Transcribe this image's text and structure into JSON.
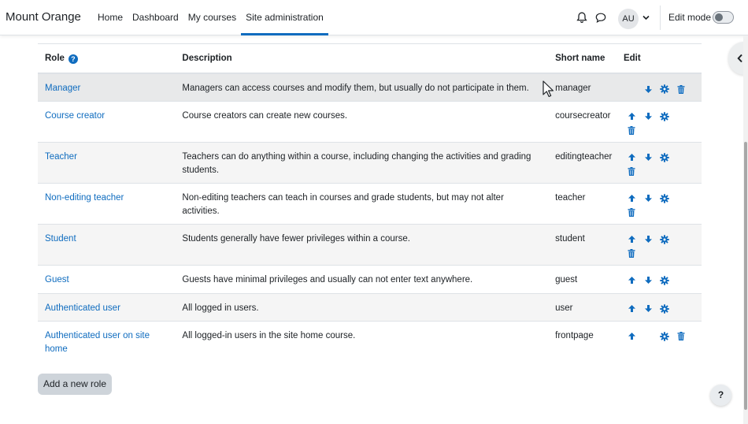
{
  "site": {
    "name": "Mount Orange"
  },
  "nav": {
    "links": [
      "Home",
      "Dashboard",
      "My courses",
      "Site administration"
    ],
    "active": "Site administration"
  },
  "user": {
    "initials": "AU"
  },
  "edit_mode": {
    "label": "Edit mode",
    "on": false
  },
  "icons": {
    "notifications": "bell-icon",
    "messages": "chat-bubble-icon",
    "user_menu": "chevron-down-icon",
    "drawer": "chevron-left-icon",
    "help": "question-mark-icon",
    "move_up": "arrow-up-icon",
    "move_down": "arrow-down-icon",
    "edit": "gear-icon",
    "delete": "trash-icon"
  },
  "colors": {
    "accent": "#0f6cbf",
    "text": "#1d2125",
    "row_stripe": "#f5f5f5",
    "row_hover": "#e8e9ea"
  },
  "table": {
    "headers": {
      "role": "Role",
      "description": "Description",
      "short_name": "Short name",
      "edit": "Edit"
    },
    "rows": [
      {
        "role": "Manager",
        "description": "Managers can access courses and modify them, but usually do not participate in them.",
        "short_name": "manager",
        "actions": [
          "down",
          "edit",
          "delete"
        ]
      },
      {
        "role": "Course creator",
        "description": "Course creators can create new courses.",
        "short_name": "coursecreator",
        "actions": [
          "up",
          "down",
          "edit",
          "delete"
        ]
      },
      {
        "role": "Teacher",
        "description": "Teachers can do anything within a course, including changing the activities and grading students.",
        "short_name": "editingteacher",
        "actions": [
          "up",
          "down",
          "edit",
          "delete"
        ]
      },
      {
        "role": "Non-editing teacher",
        "description": "Non-editing teachers can teach in courses and grade students, but may not alter activities.",
        "short_name": "teacher",
        "actions": [
          "up",
          "down",
          "edit",
          "delete"
        ]
      },
      {
        "role": "Student",
        "description": "Students generally have fewer privileges within a course.",
        "short_name": "student",
        "actions": [
          "up",
          "down",
          "edit",
          "delete"
        ]
      },
      {
        "role": "Guest",
        "description": "Guests have minimal privileges and usually can not enter text anywhere.",
        "short_name": "guest",
        "actions": [
          "up",
          "down",
          "edit"
        ]
      },
      {
        "role": "Authenticated user",
        "description": "All logged in users.",
        "short_name": "user",
        "actions": [
          "up",
          "down",
          "edit"
        ]
      },
      {
        "role": "Authenticated user on site home",
        "description": "All logged-in users in the site home course.",
        "short_name": "frontpage",
        "actions": [
          "up",
          "edit",
          "delete"
        ]
      }
    ]
  },
  "buttons": {
    "add_role": "Add a new role",
    "help": "?"
  }
}
